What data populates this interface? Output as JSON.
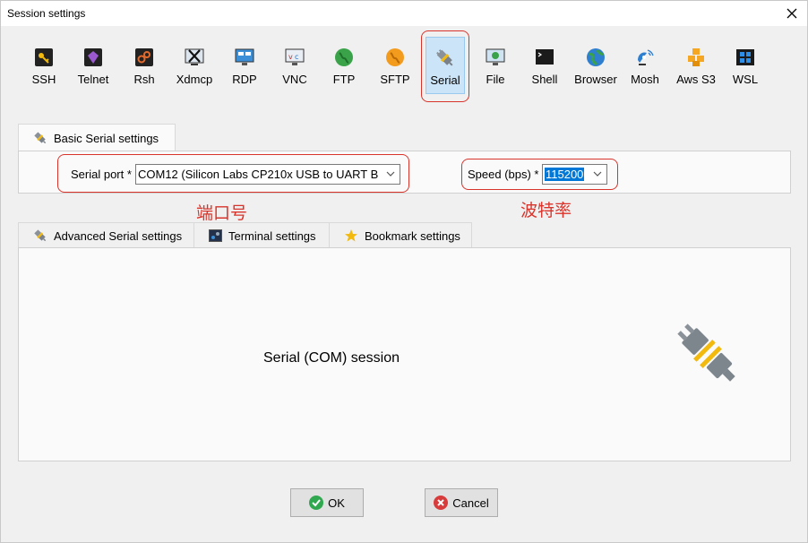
{
  "window": {
    "title": "Session settings"
  },
  "toolbar": {
    "items": [
      {
        "label": "SSH"
      },
      {
        "label": "Telnet"
      },
      {
        "label": "Rsh"
      },
      {
        "label": "Xdmcp"
      },
      {
        "label": "RDP"
      },
      {
        "label": "VNC"
      },
      {
        "label": "FTP"
      },
      {
        "label": "SFTP"
      },
      {
        "label": "Serial",
        "selected": true
      },
      {
        "label": "File"
      },
      {
        "label": "Shell"
      },
      {
        "label": "Browser"
      },
      {
        "label": "Mosh"
      },
      {
        "label": "Aws S3"
      },
      {
        "label": "WSL"
      }
    ]
  },
  "basic_tab": {
    "label": "Basic Serial settings"
  },
  "serial_port": {
    "label": "Serial port *",
    "value": "COM12  (Silicon Labs CP210x USB to UART B"
  },
  "speed": {
    "label": "Speed (bps) *",
    "value": "115200"
  },
  "annotations": {
    "port": "端口号",
    "baud": "波特率"
  },
  "lower_tabs": [
    {
      "label": "Advanced Serial settings"
    },
    {
      "label": "Terminal settings"
    },
    {
      "label": "Bookmark settings"
    }
  ],
  "content": {
    "description": "Serial (COM) session"
  },
  "buttons": {
    "ok": "OK",
    "cancel": "Cancel"
  },
  "colors": {
    "annotation": "#d9342b",
    "selection": "#cce4f7",
    "ok_green": "#2fa84f",
    "cancel_red": "#d83b3b"
  }
}
